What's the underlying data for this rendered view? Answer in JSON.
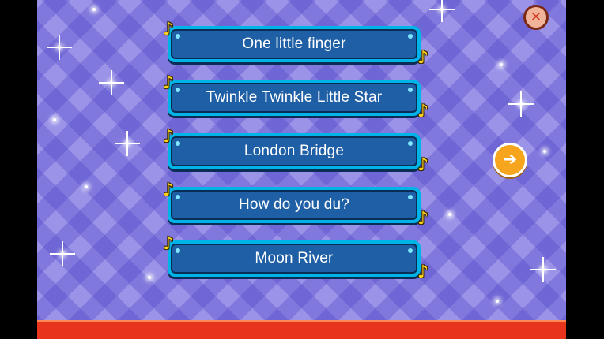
{
  "songs": [
    {
      "label": "One little finger"
    },
    {
      "label": "Twinkle Twinkle Little Star"
    },
    {
      "label": "London Bridge"
    },
    {
      "label": "How do you du?"
    },
    {
      "label": "Moon River"
    }
  ],
  "icons": {
    "note": "music-note-icon",
    "close": "close-icon",
    "next": "arrow-right-icon"
  },
  "colors": {
    "background": "#9a93e8",
    "button_fill": "#1f5fa5",
    "button_rim": "#00b4e8",
    "note": "#ffd21a",
    "next_button": "#f7a51d",
    "close_button": "#f2b39b",
    "bottom_bar": "#e8341c"
  }
}
